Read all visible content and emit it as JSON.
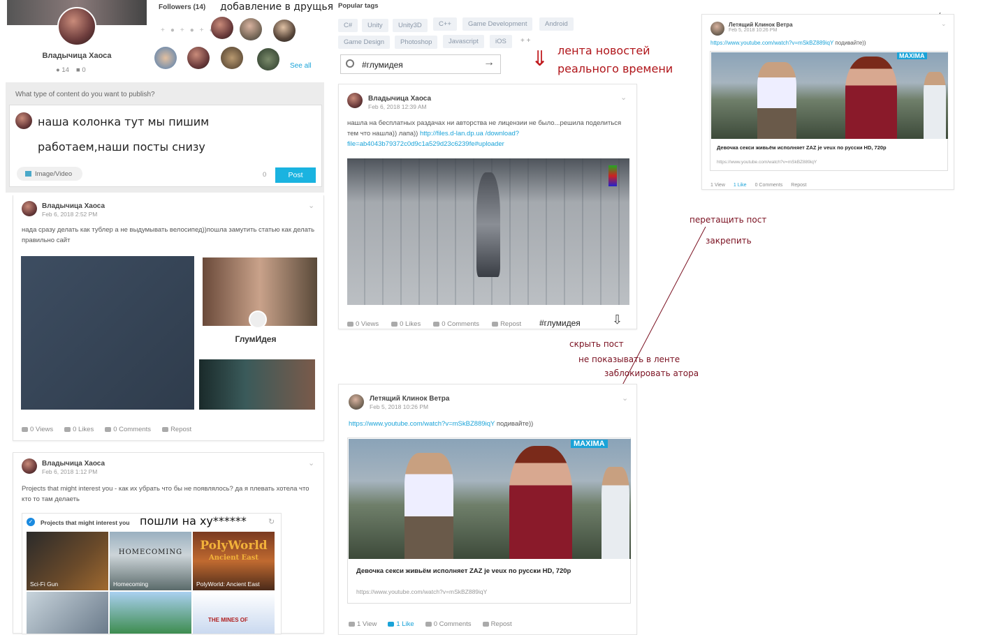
{
  "profile": {
    "name": "Владычица Хаоса",
    "followers_count": "14",
    "likes_count": "0"
  },
  "followers": {
    "title": "Followers (14)",
    "see_all": "See all",
    "note": "добавление в друщья"
  },
  "tags": {
    "title": "Popular tags",
    "items": [
      "C#",
      "Unity",
      "Unity3D",
      "C++",
      "Game Development",
      "Android",
      "Game Design",
      "Photoshop",
      "Javascript",
      "iOS"
    ],
    "more": "+ +"
  },
  "search": {
    "value": "#глумидея"
  },
  "notes": {
    "realtime_1": "лента новостей",
    "realtime_2": "реального времени",
    "drag": "перетащить пост",
    "pin": "закрепить",
    "hide_post": "скрыть пост",
    "hide_feed": "не показывать в ленте",
    "block": "заблокировать атора",
    "column_1": "наша колонка тут мы пишим",
    "column_2": "работаем,наши посты снизу",
    "projects_note": "пошли на ху******"
  },
  "composer": {
    "prompt": "What type of content do you want to publish?",
    "media_button": "Image/Video",
    "count": "0",
    "post_button": "Post"
  },
  "posts": {
    "left1": {
      "author": "Владычица Хаоса",
      "date": "Feb 6, 2018 2:52 PM",
      "text": "нада сразу делать как тублер а не выдумывать велосипед))пошла замутить статью как делать правильно сайт",
      "image_title": "ГлумИдея",
      "views": "0 Views",
      "likes": "0 Likes",
      "comments": "0 Comments",
      "repost": "Repost"
    },
    "left2": {
      "author": "Владычица Хаоса",
      "date": "Feb 6, 2018 1:12 PM",
      "text": "Projects that might interest you   - как их убрать что бы не появлялось?  да  я плевать хотела что кто то там делаеть"
    },
    "mid1": {
      "author": "Владычица Хаоса",
      "date": "Feb 6, 2018 12:39 AM",
      "text": "нашла на бесплатных   раздачах   ни авторства не лицензии не было...решила поделиться тем что нашла)) лапа))",
      "link": "http://files.d-lan.dp.ua /download?file=ab4043b79372c0d9c1a529d23c6239fe#uploader",
      "views": "0 Views",
      "likes": "0 Likes",
      "comments": "0 Comments",
      "repost": "Repost",
      "hashtag": "#глумидея"
    },
    "mid2": {
      "author": "Летящий Клинок Ветра",
      "date": "Feb 5, 2018 10:26 PM",
      "link": "https://www.youtube.com/watch?v=mSkBZ889iqY",
      "link_suffix": " подивайте))",
      "embed_title": "Девочка секси живьём исполняет ZAZ je veux по русски HD, 720p",
      "embed_url": "https://www.youtube.com/watch?v=mSkBZ889iqY",
      "views": "1 View",
      "likes": "1 Like",
      "comments": "0 Comments",
      "repost": "Repost"
    },
    "right1": {
      "author": "Летящий Клинок Ветра",
      "date": "Feb 5, 2018 10:26 PM",
      "link": "https://www.youtube.com/watch?v=mSkBZ889iqY",
      "link_suffix": " подивайте))",
      "embed_title": "Девочка секси живьём исполняет ZAZ je veux по русски HD, 720p",
      "embed_url": "https://www.youtube.com/watch?v=mSkBZ889iqY",
      "views": "1 View",
      "likes": "1 Like",
      "comments": "0 Comments",
      "repost": "Repost"
    }
  },
  "projects": {
    "title": "Projects that might interest you",
    "items": [
      "Sci-Fi Gun",
      "Homecoming",
      "PolyWorld: Ancient East"
    ],
    "banner_homecoming": "HOMECOMING",
    "banner_polyworld": "PolyWorld",
    "banner_polyworld_sub": "Ancient East",
    "banner_mines": "THE MINES OF"
  },
  "colors": {
    "accent": "#1aa3d8",
    "note_red": "#b0151a",
    "note_maroon": "#7a1020"
  }
}
